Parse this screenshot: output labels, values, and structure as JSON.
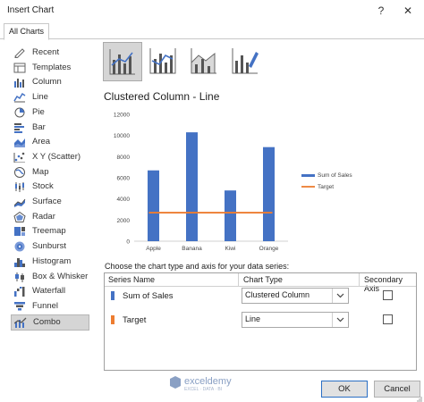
{
  "window": {
    "title": "Insert Chart",
    "help_glyph": "?",
    "close_glyph": "✕"
  },
  "tabs": [
    {
      "label": "All Charts"
    }
  ],
  "sidebar": {
    "items": [
      {
        "label": "Recent",
        "icon": "recent-icon"
      },
      {
        "label": "Templates",
        "icon": "templates-icon"
      },
      {
        "label": "Column",
        "icon": "column-chart-icon"
      },
      {
        "label": "Line",
        "icon": "line-chart-icon"
      },
      {
        "label": "Pie",
        "icon": "pie-chart-icon"
      },
      {
        "label": "Bar",
        "icon": "bar-chart-icon"
      },
      {
        "label": "Area",
        "icon": "area-chart-icon"
      },
      {
        "label": "X Y (Scatter)",
        "icon": "scatter-chart-icon"
      },
      {
        "label": "Map",
        "icon": "map-chart-icon"
      },
      {
        "label": "Stock",
        "icon": "stock-chart-icon"
      },
      {
        "label": "Surface",
        "icon": "surface-chart-icon"
      },
      {
        "label": "Radar",
        "icon": "radar-chart-icon"
      },
      {
        "label": "Treemap",
        "icon": "treemap-chart-icon"
      },
      {
        "label": "Sunburst",
        "icon": "sunburst-chart-icon"
      },
      {
        "label": "Histogram",
        "icon": "histogram-chart-icon"
      },
      {
        "label": "Box & Whisker",
        "icon": "box-whisker-chart-icon"
      },
      {
        "label": "Waterfall",
        "icon": "waterfall-chart-icon"
      },
      {
        "label": "Funnel",
        "icon": "funnel-chart-icon"
      },
      {
        "label": "Combo",
        "icon": "combo-chart-icon",
        "selected": true
      }
    ]
  },
  "subtypes": [
    {
      "name": "clustered-column-line-icon",
      "selected": true
    },
    {
      "name": "clustered-column-line-secondary-icon"
    },
    {
      "name": "stacked-area-clustered-column-icon"
    },
    {
      "name": "custom-combination-icon"
    }
  ],
  "selected_title": "Clustered Column - Line",
  "chart_data": {
    "type": "bar",
    "categories": [
      "Apple",
      "Banana",
      "Kiwi",
      "Orange"
    ],
    "series": [
      {
        "name": "Sum of Sales",
        "type": "bar",
        "color": "#4472c4",
        "values": [
          6700,
          10300,
          4800,
          8900
        ]
      },
      {
        "name": "Target",
        "type": "line",
        "color": "#ed7d31",
        "values": [
          2700,
          2700,
          2700,
          2700
        ]
      }
    ],
    "ylim": [
      0,
      12000
    ],
    "yticks": [
      "0",
      "2000",
      "4000",
      "6000",
      "8000",
      "10000",
      "12000"
    ],
    "grid": false,
    "legend": "right"
  },
  "choose_label": "Choose the chart type and axis for your data series:",
  "table": {
    "headers": [
      "Series Name",
      "Chart Type",
      "Secondary Axis"
    ],
    "rows": [
      {
        "name": "Sum of Sales",
        "color": "#4472c4",
        "type": "Clustered Column",
        "secondary": false
      },
      {
        "name": "Target",
        "color": "#ed7d31",
        "type": "Line",
        "secondary": false
      }
    ]
  },
  "watermark": {
    "name": "exceldemy",
    "tagline": "EXCEL · DATA · BI"
  },
  "buttons": {
    "ok": "OK",
    "cancel": "Cancel"
  }
}
